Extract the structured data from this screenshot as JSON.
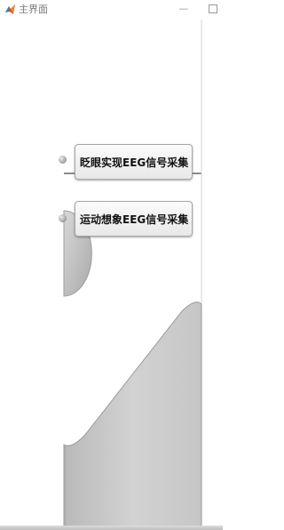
{
  "window": {
    "title": "主界面",
    "minimize_glyph": "—",
    "icon": "matlab-icon"
  },
  "buttons": {
    "blink_eeg": "眨眼实现EEG信号采集",
    "motor_imagery_eeg": "运动想象EEG信号采集"
  },
  "colors": {
    "background": "#ffffff",
    "graphic_gray": "#c4c4c4",
    "graphic_dark": "#8f8f8f",
    "button_face": "#f1f1f1"
  }
}
